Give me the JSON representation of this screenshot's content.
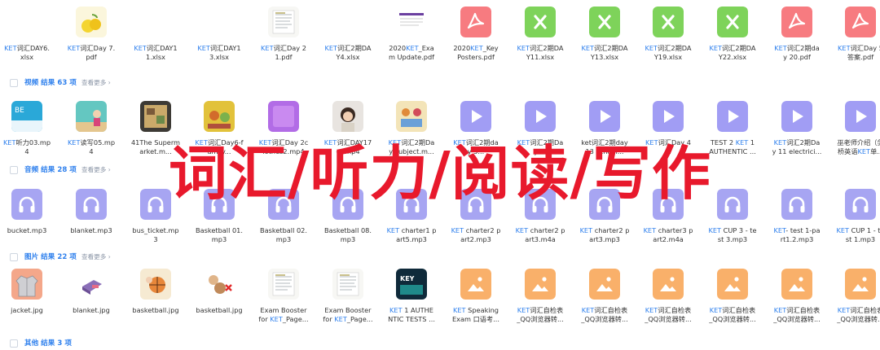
{
  "keyword": "KET",
  "colors": {
    "accent": "#2f80ed",
    "overlay": "#e8192c",
    "pdf": "#f77b80",
    "xlsx": "#7ed35a",
    "video": "#a19df4",
    "audio": "#a7a5f2",
    "image": "#f9b06a"
  },
  "rows": [
    {
      "top": 0,
      "items": [
        {
          "thumb": "doc-blank-thumbnail",
          "name": [
            {
              "t": "KET",
              "k": true
            },
            {
              "t": "词汇DAY6."
            },
            {
              "t": "xlsx"
            }
          ]
        },
        {
          "thumb": "lemon-image-thumbnail",
          "name": [
            {
              "t": "KET",
              "k": true
            },
            {
              "t": "词汇Day 7."
            },
            {
              "t": "pdf"
            }
          ]
        },
        {
          "thumb": "doc-blank-thumbnail",
          "name": [
            {
              "t": "KET",
              "k": true
            },
            {
              "t": "词汇DAY1"
            },
            {
              "t": "1.xlsx"
            }
          ]
        },
        {
          "thumb": "doc-blank-thumbnail",
          "name": [
            {
              "t": "KET",
              "k": true
            },
            {
              "t": "词汇DAY1"
            },
            {
              "t": "3.xlsx"
            }
          ]
        },
        {
          "thumb": "document-page-thumbnail",
          "name": [
            {
              "t": "KET",
              "k": true
            },
            {
              "t": "词汇Day 2"
            },
            {
              "t": "1.pdf"
            }
          ]
        },
        {
          "thumb": "doc-blank-thumbnail",
          "name": [
            {
              "t": "KET",
              "k": true
            },
            {
              "t": "词汇2期DA"
            },
            {
              "t": "Y4.xlsx"
            }
          ]
        },
        {
          "thumb": "exam-update-thumbnail",
          "name": [
            {
              "t": "2020"
            },
            {
              "t": "KET",
              "k": true
            },
            {
              "t": "_Exa"
            },
            {
              "t": "m Update.pdf"
            }
          ]
        },
        {
          "thumb": "pdf-icon",
          "name": [
            {
              "t": "2020"
            },
            {
              "t": "KET",
              "k": true
            },
            {
              "t": "_Key"
            },
            {
              "t": "Posters.pdf"
            }
          ]
        },
        {
          "thumb": "xlsx-icon",
          "name": [
            {
              "t": "KET",
              "k": true
            },
            {
              "t": "词汇2期DA"
            },
            {
              "t": "Y11.xlsx"
            }
          ]
        },
        {
          "thumb": "xlsx-icon",
          "name": [
            {
              "t": "KET",
              "k": true
            },
            {
              "t": "词汇2期DA"
            },
            {
              "t": "Y13.xlsx"
            }
          ]
        },
        {
          "thumb": "xlsx-icon",
          "name": [
            {
              "t": "KET",
              "k": true
            },
            {
              "t": "词汇2期DA"
            },
            {
              "t": "Y19.xlsx"
            }
          ]
        },
        {
          "thumb": "xlsx-icon",
          "name": [
            {
              "t": "KET",
              "k": true
            },
            {
              "t": "词汇2期DA"
            },
            {
              "t": "Y22.xlsx"
            }
          ]
        },
        {
          "thumb": "pdf-icon",
          "name": [
            {
              "t": "KET",
              "k": true
            },
            {
              "t": "词汇2期da"
            },
            {
              "t": "y 20.pdf"
            }
          ]
        },
        {
          "thumb": "pdf-icon",
          "name": [
            {
              "t": "KET",
              "k": true
            },
            {
              "t": "词汇Day 5"
            },
            {
              "t": "答案.pdf"
            }
          ]
        }
      ]
    },
    {
      "items": [
        {
          "thumb": "video-photo-thumbnail",
          "name": [
            {
              "t": "KET",
              "k": true
            },
            {
              "t": "听力03.mp"
            },
            {
              "t": "4"
            }
          ]
        },
        {
          "thumb": "video-photo-thumbnail-2",
          "name": [
            {
              "t": "KET",
              "k": true
            },
            {
              "t": "读写05.mp"
            },
            {
              "t": "4"
            }
          ]
        },
        {
          "thumb": "video-photo-thumbnail-3",
          "name": [
            {
              "t": "41The Superm"
            },
            {
              "t": "arket.m..."
            }
          ]
        },
        {
          "thumb": "video-photo-thumbnail-4",
          "name": [
            {
              "t": "KET",
              "k": true
            },
            {
              "t": "词汇Day6-f"
            },
            {
              "t": "amily..."
            }
          ]
        },
        {
          "thumb": "video-purple-thumbnail",
          "name": [
            {
              "t": "KET",
              "k": true
            },
            {
              "t": "词汇Day 2c"
            },
            {
              "t": "lothes2.mp4"
            }
          ]
        },
        {
          "thumb": "video-face-thumbnail",
          "name": [
            {
              "t": "KET",
              "k": true
            },
            {
              "t": "词汇DAY17"
            },
            {
              "t": "-...mp4"
            }
          ]
        },
        {
          "thumb": "video-photo-thumbnail-5",
          "name": [
            {
              "t": "KET",
              "k": true
            },
            {
              "t": "词汇2期Da"
            },
            {
              "t": "y subject.m..."
            }
          ]
        },
        {
          "thumb": "video-icon",
          "name": [
            {
              "t": "KET",
              "k": true
            },
            {
              "t": "词汇2期da"
            },
            {
              "t": "y 5..."
            }
          ]
        },
        {
          "thumb": "video-icon",
          "name": [
            {
              "t": "KET",
              "k": true
            },
            {
              "t": "词汇2期Da"
            },
            {
              "t": "y ..."
            }
          ]
        },
        {
          "thumb": "video-icon",
          "name": [
            {
              "t": "ket词汇2期day"
            },
            {
              "t": "13 school..."
            }
          ]
        },
        {
          "thumb": "video-icon",
          "name": [
            {
              "t": "KET",
              "k": true
            },
            {
              "t": "词汇Day 4"
            },
            {
              "t": "..."
            }
          ]
        },
        {
          "thumb": "video-icon",
          "name": [
            {
              "t": "TEST 2 "
            },
            {
              "t": "KET",
              "k": true
            },
            {
              "t": " 1"
            },
            {
              "t": "AUTHENTIC ..."
            }
          ]
        },
        {
          "thumb": "video-icon",
          "name": [
            {
              "t": "KET",
              "k": true
            },
            {
              "t": "词汇2期Da"
            },
            {
              "t": "y 11 electrici..."
            }
          ]
        },
        {
          "thumb": "video-icon",
          "name": [
            {
              "t": "巫老师介绍（剑"
            },
            {
              "t": "桥英语"
            },
            {
              "t": "KET",
              "k": true
            },
            {
              "t": "单..."
            }
          ]
        }
      ]
    },
    {
      "items": [
        {
          "thumb": "audio-icon",
          "name": [
            {
              "t": "bucket.mp3"
            }
          ]
        },
        {
          "thumb": "audio-icon",
          "name": [
            {
              "t": "blanket.mp3"
            }
          ]
        },
        {
          "thumb": "audio-icon",
          "name": [
            {
              "t": "bus_ticket.mp"
            },
            {
              "t": "3"
            }
          ]
        },
        {
          "thumb": "audio-icon",
          "name": [
            {
              "t": "Basketball 01."
            },
            {
              "t": "mp3"
            }
          ]
        },
        {
          "thumb": "audio-icon",
          "name": [
            {
              "t": "Basketball 02."
            },
            {
              "t": "mp3"
            }
          ]
        },
        {
          "thumb": "audio-icon",
          "name": [
            {
              "t": "Basketball 08."
            },
            {
              "t": "mp3"
            }
          ]
        },
        {
          "thumb": "audio-icon",
          "name": [
            {
              "t": "KET",
              "k": true
            },
            {
              "t": " charter1 p"
            },
            {
              "t": "art5.mp3"
            }
          ]
        },
        {
          "thumb": "audio-icon",
          "name": [
            {
              "t": "KET",
              "k": true
            },
            {
              "t": " charter2 p"
            },
            {
              "t": "art2.mp3"
            }
          ]
        },
        {
          "thumb": "audio-icon",
          "name": [
            {
              "t": "KET",
              "k": true
            },
            {
              "t": " charter2 p"
            },
            {
              "t": "art3.m4a"
            }
          ]
        },
        {
          "thumb": "audio-icon",
          "name": [
            {
              "t": "KET",
              "k": true
            },
            {
              "t": " charter2 p"
            },
            {
              "t": "art3.mp3"
            }
          ]
        },
        {
          "thumb": "audio-icon",
          "name": [
            {
              "t": "KET",
              "k": true
            },
            {
              "t": " charter3 p"
            },
            {
              "t": "art2.m4a"
            }
          ]
        },
        {
          "thumb": "audio-icon",
          "name": [
            {
              "t": "KET",
              "k": true
            },
            {
              "t": " CUP 3 - te"
            },
            {
              "t": "st 3.mp3"
            }
          ]
        },
        {
          "thumb": "audio-icon",
          "name": [
            {
              "t": "KET",
              "k": true
            },
            {
              "t": "- test 1-pa"
            },
            {
              "t": "rt1.2.mp3"
            }
          ]
        },
        {
          "thumb": "audio-icon",
          "name": [
            {
              "t": "KET",
              "k": true
            },
            {
              "t": " CUP 1 - te"
            },
            {
              "t": "st 1.mp3"
            }
          ]
        }
      ]
    },
    {
      "items": [
        {
          "thumb": "jacket-image-thumbnail",
          "name": [
            {
              "t": "jacket.jpg"
            }
          ]
        },
        {
          "thumb": "blanket-image-thumbnail",
          "name": [
            {
              "t": "blanket.jpg"
            }
          ]
        },
        {
          "thumb": "basketball-image-thumbnail",
          "name": [
            {
              "t": "basketball.jpg"
            }
          ]
        },
        {
          "thumb": "basketball-image-thumbnail-2",
          "name": [
            {
              "t": "basketball.jpg"
            }
          ]
        },
        {
          "thumb": "document-page-thumbnail",
          "name": [
            {
              "t": "Exam Booster"
            },
            {
              "t": "for "
            },
            {
              "t": "KET",
              "k": true
            },
            {
              "t": "_Page..."
            }
          ]
        },
        {
          "thumb": "document-page-thumbnail",
          "name": [
            {
              "t": "Exam Booster"
            },
            {
              "t": "for "
            },
            {
              "t": "KET",
              "k": true
            },
            {
              "t": "_Page..."
            }
          ]
        },
        {
          "thumb": "key-book-thumbnail",
          "name": [
            {
              "t": "KET",
              "k": true
            },
            {
              "t": " 1 AUTHE"
            },
            {
              "t": "NTIC TESTS ..."
            }
          ]
        },
        {
          "thumb": "image-icon",
          "name": [
            {
              "t": "KET",
              "k": true
            },
            {
              "t": " Speaking"
            },
            {
              "t": "Exam 口语考..."
            }
          ]
        },
        {
          "thumb": "image-icon",
          "name": [
            {
              "t": "KET",
              "k": true
            },
            {
              "t": "词汇自检表"
            },
            {
              "t": "_QQ浏览器转..."
            }
          ]
        },
        {
          "thumb": "image-icon",
          "name": [
            {
              "t": "KET",
              "k": true
            },
            {
              "t": "词汇自检表"
            },
            {
              "t": "_QQ浏览器转..."
            }
          ]
        },
        {
          "thumb": "image-icon",
          "name": [
            {
              "t": "KET",
              "k": true
            },
            {
              "t": "词汇自检表"
            },
            {
              "t": "_QQ浏览器转..."
            }
          ]
        },
        {
          "thumb": "image-icon",
          "name": [
            {
              "t": "KET",
              "k": true
            },
            {
              "t": "词汇自检表"
            },
            {
              "t": "_QQ浏览器转..."
            }
          ]
        },
        {
          "thumb": "image-icon",
          "name": [
            {
              "t": "KET",
              "k": true
            },
            {
              "t": "词汇自检表"
            },
            {
              "t": "_QQ浏览器转..."
            }
          ]
        },
        {
          "thumb": "image-icon",
          "name": [
            {
              "t": "KET",
              "k": true
            },
            {
              "t": "词汇自检表"
            },
            {
              "t": "_QQ浏览器转..."
            }
          ]
        }
      ]
    }
  ],
  "sections": [
    {
      "title": "视频 结果 63 项",
      "more": "查看更多 ›"
    },
    {
      "title": "音频 结果 28 项",
      "more": "查看更多 ›"
    },
    {
      "title": "图片 结果 22 项",
      "more": "查看更多 ›"
    },
    {
      "title": "其他 结果 3 项",
      "more": ""
    }
  ],
  "overlay_text": "词汇/听力/阅读/写作"
}
